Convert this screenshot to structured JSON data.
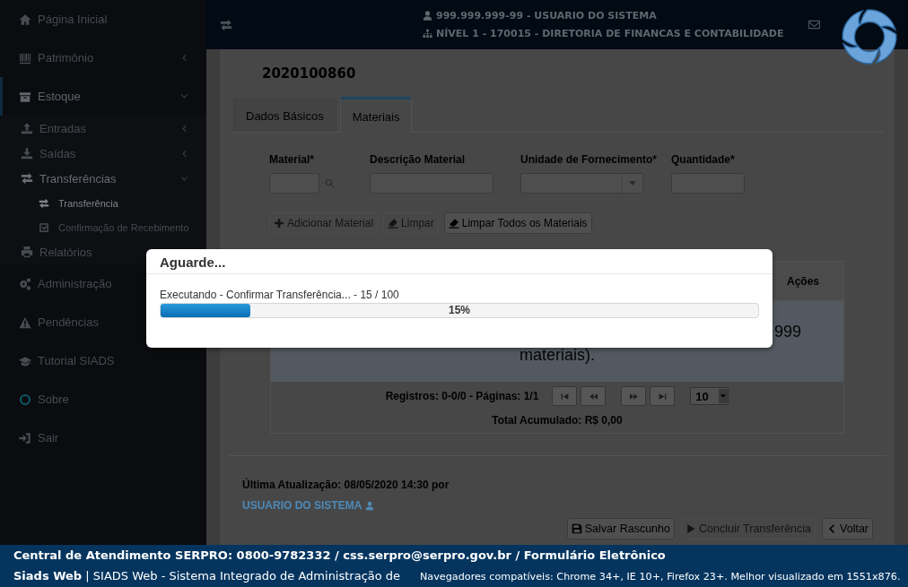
{
  "sidebar": {
    "items": [
      {
        "label": "Página Inicial",
        "selected": false
      },
      {
        "label": "Patrimônio",
        "selected": false,
        "expanded": false
      },
      {
        "label": "Estoque",
        "selected": true,
        "expanded": true,
        "children": [
          {
            "label": "Entradas",
            "selected": false,
            "expanded": false
          },
          {
            "label": "Saídas",
            "selected": false,
            "expanded": false
          },
          {
            "label": "Transferências",
            "selected": false,
            "expanded": true,
            "children": [
              {
                "label": "Transferência",
                "selected": true
              },
              {
                "label": "Confirmação de Recebimento",
                "selected": false
              }
            ]
          },
          {
            "label": "Relatórios",
            "selected": false
          }
        ]
      },
      {
        "label": "Administração",
        "selected": false
      },
      {
        "label": "Pendências",
        "selected": false
      },
      {
        "label": "Tutorial SIADS",
        "selected": false
      },
      {
        "label": "Sobre",
        "selected": false
      },
      {
        "label": "Sair",
        "selected": false
      }
    ]
  },
  "header": {
    "user_line": "999.999.999-99 - USUARIO DO SISTEMA",
    "unit_line": "NÍVEL 1 - 170015 - DIRETORIA DE FINANCAS E CONTABILIDADE"
  },
  "document": {
    "number": "2020100860"
  },
  "tabs": [
    {
      "label": "Dados Básicos",
      "selected": false
    },
    {
      "label": "Materiais",
      "selected": true
    }
  ],
  "fields": [
    {
      "label": "Material*",
      "kind": "lookup"
    },
    {
      "label": "Descrição Material",
      "kind": "text"
    },
    {
      "label": "Unidade de Fornecimento*",
      "kind": "select"
    },
    {
      "label": "Quantidade*",
      "kind": "text"
    }
  ],
  "material_buttons": [
    {
      "label": "Adicionar Material",
      "disabled": true
    },
    {
      "label": "Limpar",
      "disabled": true
    },
    {
      "label": "Limpar Todos os Materiais",
      "disabled": false
    }
  ],
  "table": {
    "columns": [
      {
        "label": "Ações"
      }
    ],
    "empty_message": [
      "999",
      "materiais)."
    ],
    "pager": {
      "summary": "Registros: 0-0/0 - Páginas: 1/1",
      "page_size": "10"
    },
    "total": "Total Acumulado: R$ 0,00"
  },
  "last_update": {
    "text": "Última Atualização: 08/05/2020 14:30 por",
    "user_link": "USUARIO DO SISTEMA"
  },
  "actions": [
    {
      "label": "Salvar Rascunho",
      "disabled": false
    },
    {
      "label": "Concluir Transferência",
      "disabled": true
    },
    {
      "label": "Voltar",
      "disabled": false
    }
  ],
  "dialog": {
    "title": "Aguarde...",
    "message": "Executando - Confirmar Transferência... - 15 / 100",
    "progress": {
      "level": 0.15,
      "reading": "15%"
    }
  },
  "footer": {
    "contact_line": "Central de Atendimento SERPRO: 0800-9782332 / css.serpro@serpro.gov.br / Formulário Eletrônico",
    "system": "**Siads Web** | SIADS Web - Sistema Integrado de Administração de",
    "browsers": "Navegadores compatíveis: Chrome 34+, IE 10+, Firefox 23+. Melhor visualizado em 1551x876."
  }
}
